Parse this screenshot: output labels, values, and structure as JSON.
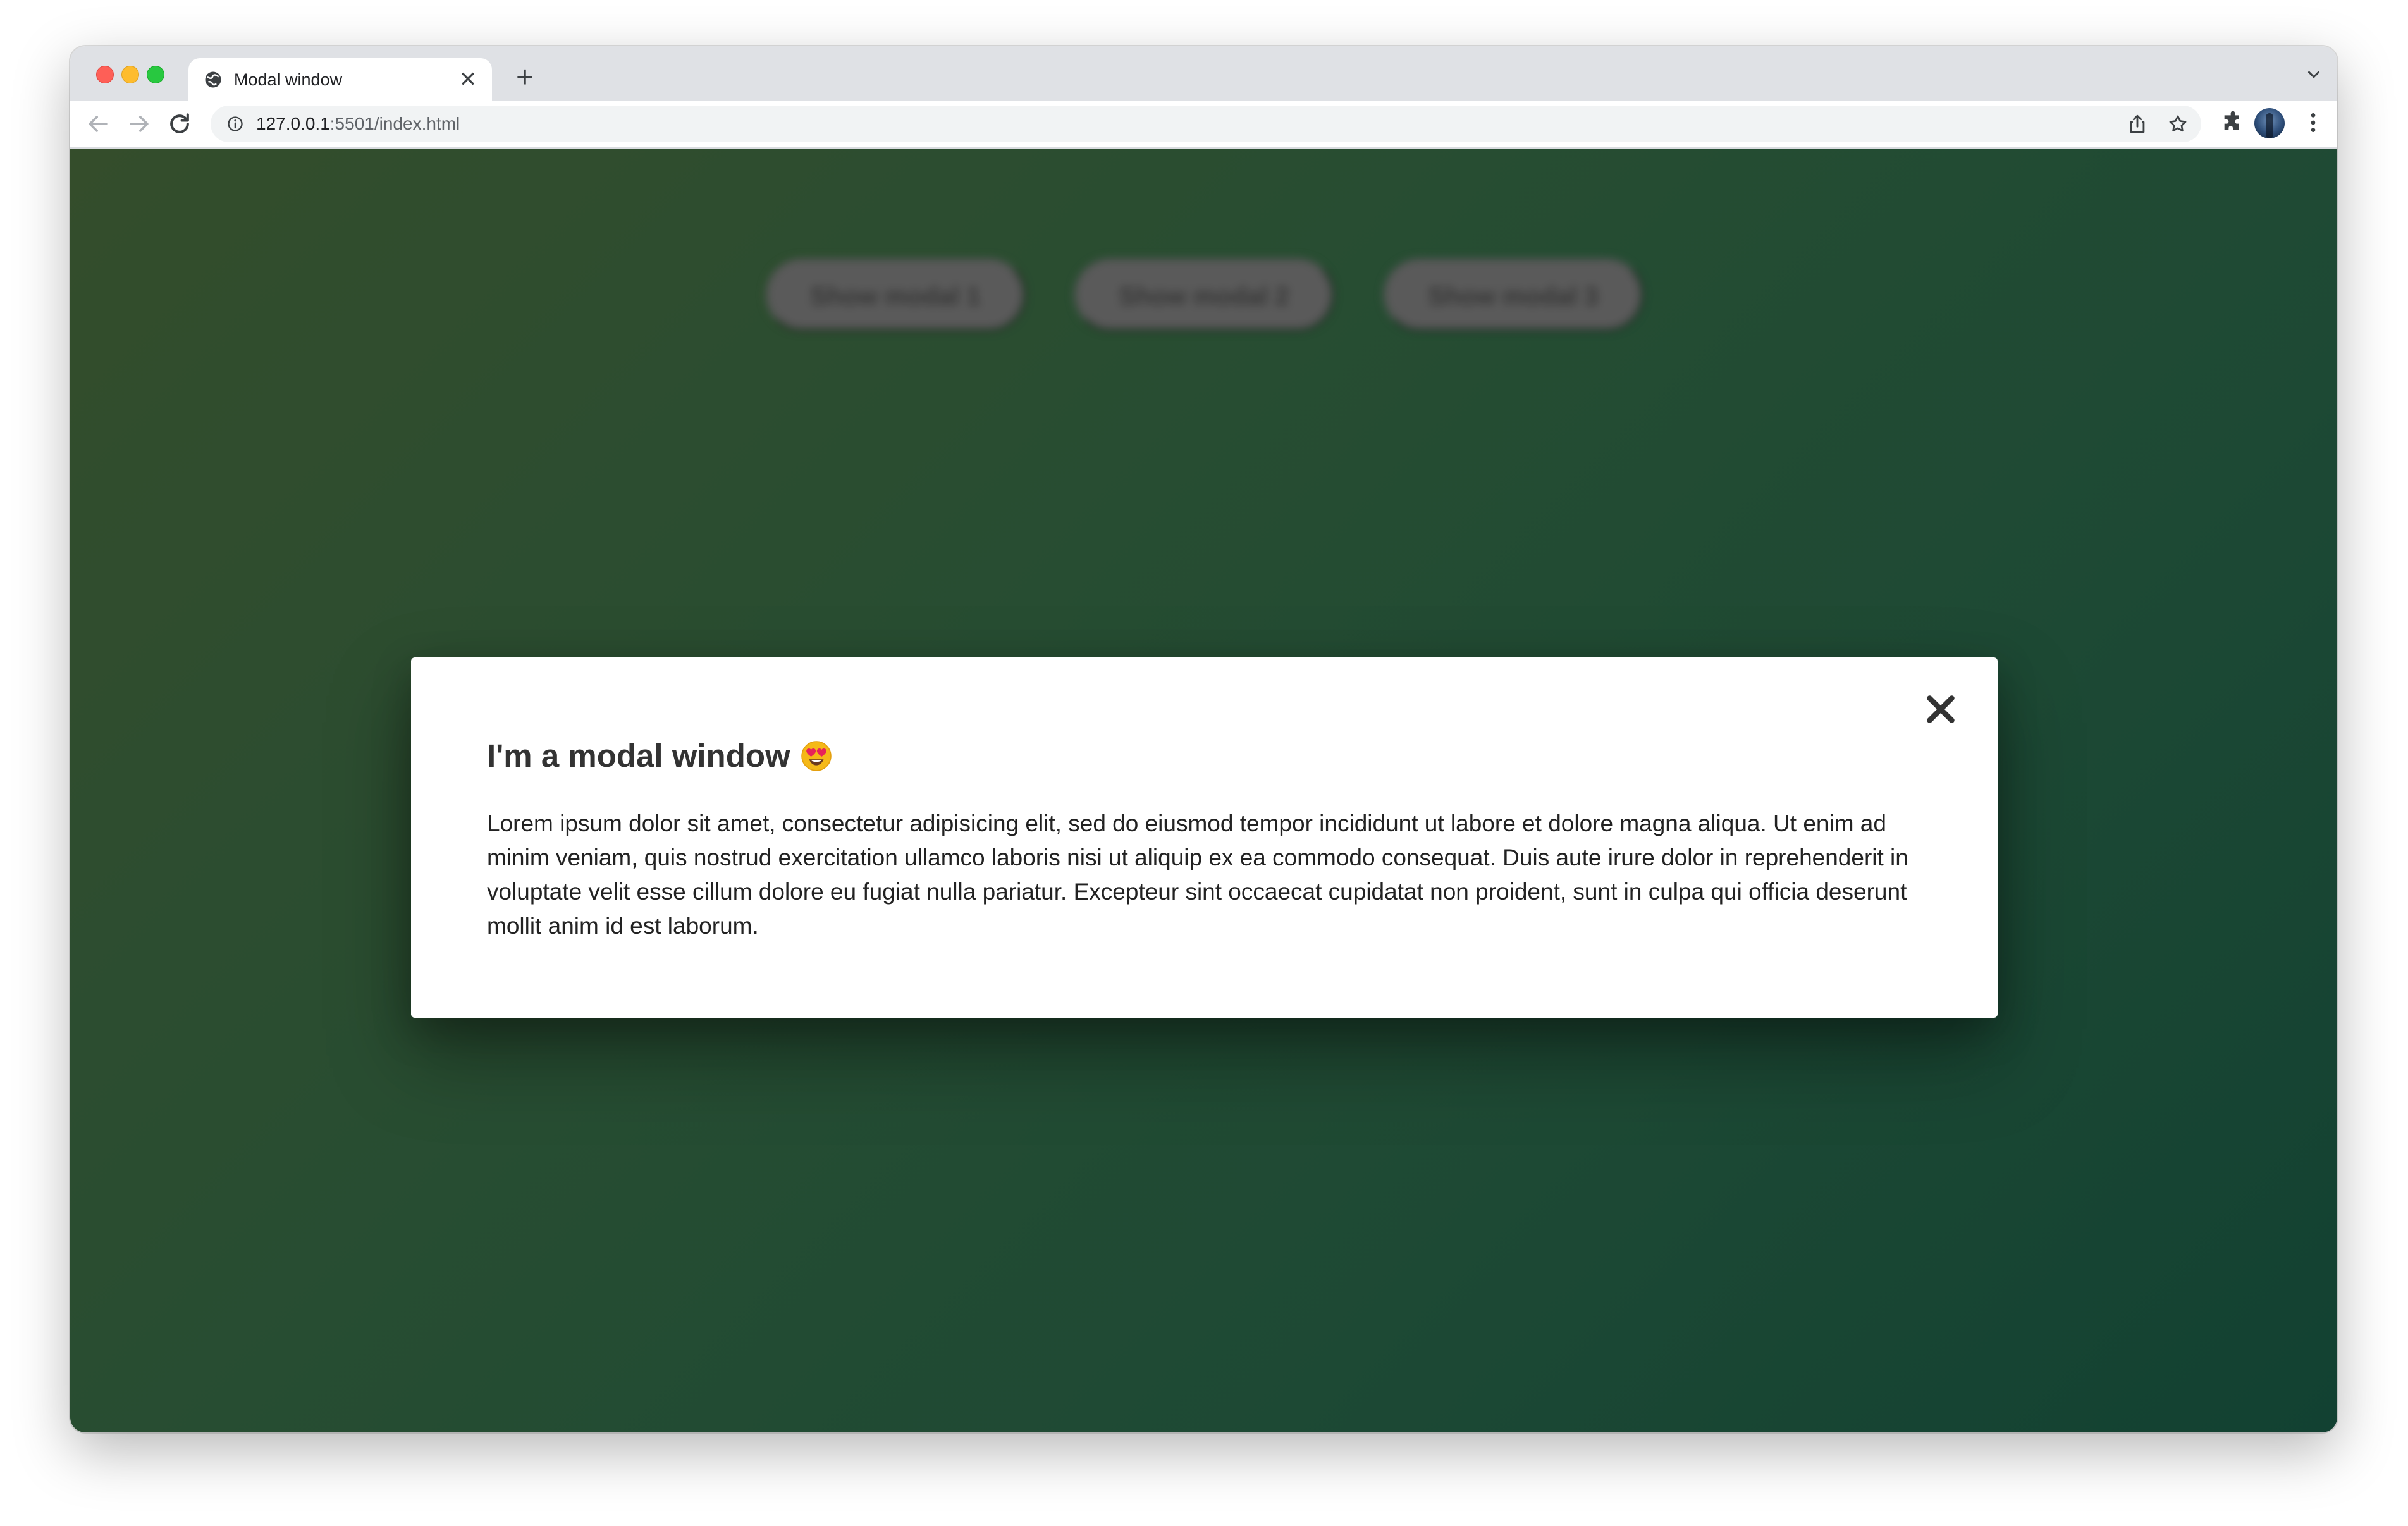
{
  "browser": {
    "tab_title": "Modal window",
    "tab_close_icon": "close-icon",
    "new_tab_icon": "plus-icon",
    "url_host": "127.0.0.1",
    "url_path": ":5501/index.html",
    "icons": [
      "back-arrow-icon",
      "forward-arrow-icon",
      "reload-icon",
      "info-icon",
      "share-icon",
      "star-icon",
      "puzzle-icon",
      "avatar",
      "more-vert-icon",
      "chevron-down-icon"
    ]
  },
  "page": {
    "buttons": [
      {
        "label": "Show modal 1"
      },
      {
        "label": "Show modal 2"
      },
      {
        "label": "Show modal 3"
      }
    ],
    "background_colors": [
      "#38522e",
      "#144636"
    ]
  },
  "modal": {
    "title": "I'm a modal window",
    "emoji_icon": "heart-eyes-emoji-icon",
    "close_icon": "close-icon",
    "body": "Lorem ipsum dolor sit amet, consectetur adipisicing elit, sed do eiusmod tempor incididunt ut labore et dolore magna aliqua. Ut enim ad minim veniam, quis nostrud exercitation ullamco laboris nisi ut aliquip ex ea commodo consequat. Duis aute irure dolor in reprehenderit in voluptate velit esse cillum dolore eu fugiat nulla pariatur. Excepteur sint occaecat cupidatat non proident, sunt in culpa qui officia deserunt mollit anim id est laborum."
  }
}
